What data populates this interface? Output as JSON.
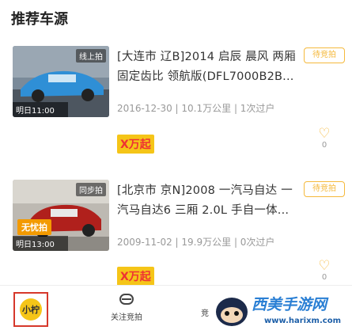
{
  "section": {
    "title": "推荐车源"
  },
  "listings": [
    {
      "status_tag": "线上拍",
      "auction_time": "明日11:00",
      "title": "[大连市 辽B]2014 启辰 晨风 两厢 固定齿比 领航版(DFL7000B2B...",
      "meta": "2016-12-30 | 10.1万公里 | 1次过户",
      "pill": "待竞拍",
      "price": "X万起",
      "fav_count": "0"
    },
    {
      "status_tag": "同步拍",
      "auction_time": "明日13:00",
      "free_badge": "无忧拍",
      "title": "[北京市 京N]2008 一汽马自达 一汽马自达6 三厢 2.0L 手自一体...",
      "meta": "2009-11-02 | 19.9万公里 | 0次过户",
      "pill": "待竞拍",
      "price": "X万起",
      "fav_count": "0"
    }
  ],
  "tabbar": {
    "home_label": "小柠",
    "follow_label": "关注竞拍",
    "third_label": "竞"
  },
  "watermark": {
    "brand": "西美手游网",
    "url": "www.harixm.com"
  },
  "colors": {
    "accent_yellow": "#f5c518",
    "price_red": "#e33333",
    "pill_orange": "#f5b93c",
    "active_border": "#d6382b"
  }
}
